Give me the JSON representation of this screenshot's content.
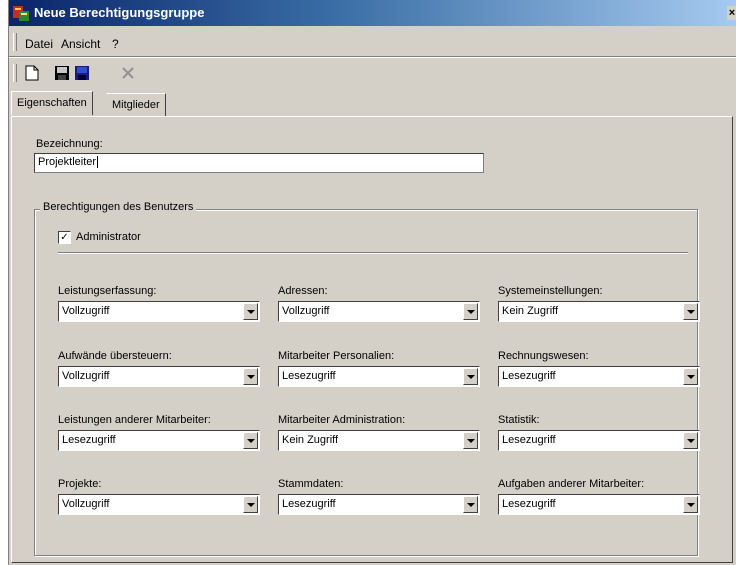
{
  "window": {
    "title": "Neue Berechtigungsgruppe",
    "close_glyph": "×"
  },
  "menu": [
    "Datei",
    "Ansicht",
    "?"
  ],
  "toolbar": [
    "new-document-icon",
    "save-icon",
    "save-all-icon",
    "delete-icon"
  ],
  "tabs": [
    {
      "label": "Eigenschaften",
      "active": true
    },
    {
      "label": "Mitglieder",
      "active": false
    }
  ],
  "form": {
    "bezeichnung_label": "Bezeichnung:",
    "bezeichnung_value": "Projektleiter"
  },
  "permissions": {
    "group_title": "Berechtigungen des Benutzers",
    "admin_label": "Administrator",
    "admin_checked": true,
    "check_glyph": "✓",
    "fields": [
      {
        "label": "Leistungserfassung:",
        "value": "Vollzugriff"
      },
      {
        "label": "Adressen:",
        "value": "Vollzugriff"
      },
      {
        "label": "Systemeinstellungen:",
        "value": "Kein Zugriff"
      },
      {
        "label": "Aufwände übersteuern:",
        "value": "Vollzugriff"
      },
      {
        "label": "Mitarbeiter Personalien:",
        "value": "Lesezugriff"
      },
      {
        "label": "Rechnungswesen:",
        "value": "Lesezugriff"
      },
      {
        "label": "Leistungen anderer Mitarbeiter:",
        "value": "Lesezugriff"
      },
      {
        "label": "Mitarbeiter Administration:",
        "value": "Kein Zugriff"
      },
      {
        "label": "Statistik:",
        "value": "Lesezugriff"
      },
      {
        "label": "Projekte:",
        "value": "Vollzugriff"
      },
      {
        "label": "Stammdaten:",
        "value": "Lesezugriff"
      },
      {
        "label": "Aufgaben anderer Mitarbeiter:",
        "value": "Lesezugriff"
      }
    ]
  }
}
